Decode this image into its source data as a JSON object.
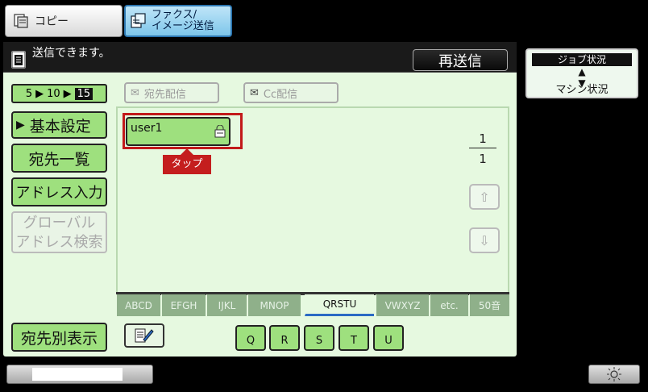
{
  "tabs": {
    "copy": "コピー",
    "fax_line1": "ファクス/",
    "fax_line2": "イメージ送信"
  },
  "status": {
    "message": "送信できます。",
    "resend_label": "再送信"
  },
  "job_status": {
    "top": "ジョブ状況",
    "bottom": "マシン状況"
  },
  "left_menu": {
    "counter": [
      "5",
      "10",
      "15"
    ],
    "basic_settings": "基本設定",
    "address_list": "宛先一覧",
    "address_input": "アドレス入力",
    "global_line1": "グローバル",
    "global_line2": "アドレス検索",
    "address_view": "宛先別表示"
  },
  "send_buttons": {
    "to": "宛先配信",
    "cc": "Cc配信"
  },
  "addresses": [
    {
      "name": "user1"
    }
  ],
  "tap_label": "タップ",
  "pagination": {
    "current": "1",
    "total": "1"
  },
  "alpha_tabs": [
    "ABCD",
    "EFGH",
    "IJKL",
    "MNOP",
    "QRSTU",
    "VWXYZ",
    "etc.",
    "50音"
  ],
  "active_alpha_tab": "QRSTU",
  "letters": [
    "Q",
    "R",
    "S",
    "T",
    "U"
  ],
  "colors": {
    "panel": "#e6f9e0",
    "button_green": "#9ee07e",
    "highlight_red": "#c21a1a",
    "active_tab_underline": "#2b6bc4"
  }
}
